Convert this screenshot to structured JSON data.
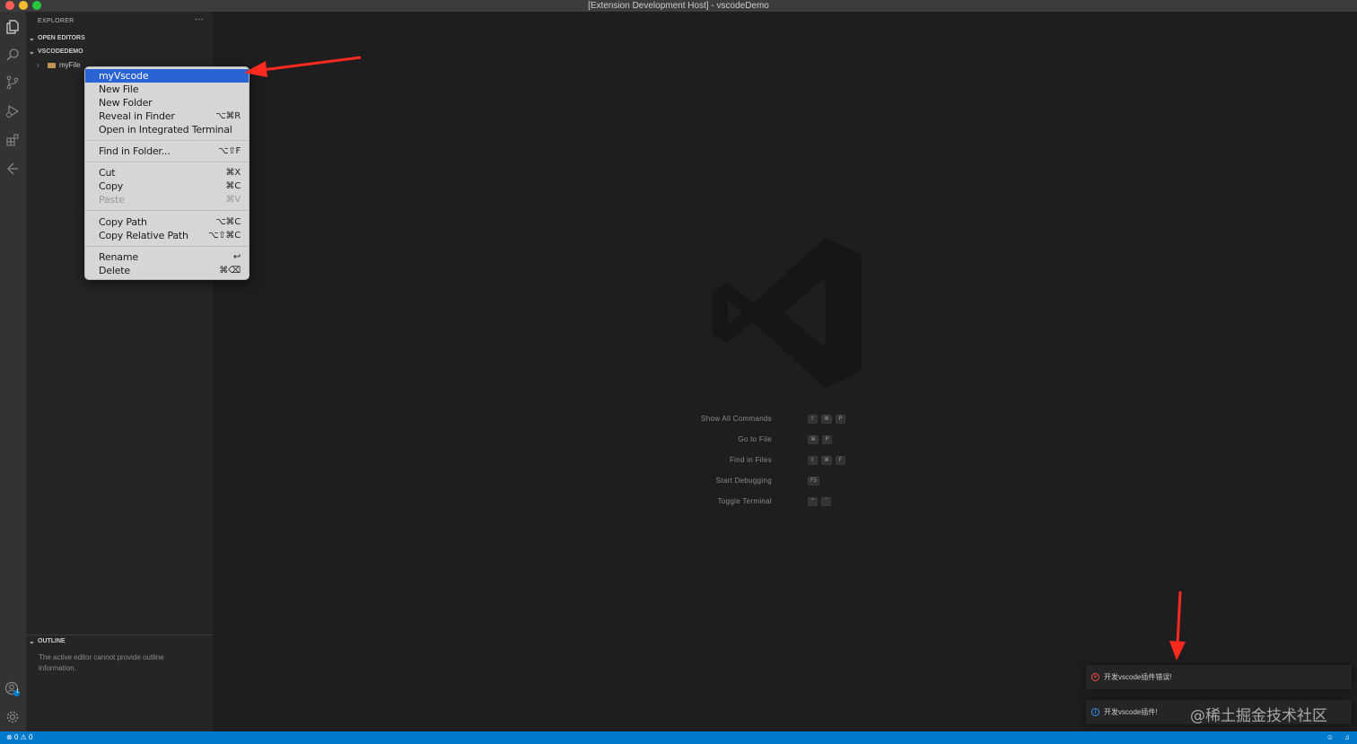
{
  "window": {
    "title": "[Extension Development Host] - vscodeDemo"
  },
  "activity_bar": {
    "icons": [
      "files-icon",
      "search-icon",
      "source-control-icon",
      "run-debug-icon",
      "extensions-icon",
      "remote-icon",
      "accounts-icon",
      "settings-gear-icon"
    ],
    "accounts_badge": "1"
  },
  "sidebar": {
    "header": "EXPLORER",
    "more": "···",
    "open_editors": "OPEN EDITORS",
    "workspace": "VSCODEDEMO",
    "tree": [
      {
        "label": "myFile"
      }
    ],
    "outline": {
      "header": "OUTLINE",
      "message": "The active editor cannot provide outline information."
    }
  },
  "context_menu": {
    "items": [
      {
        "label": "myVscode",
        "shortcut": ""
      },
      {
        "label": "New File",
        "shortcut": ""
      },
      {
        "label": "New Folder",
        "shortcut": ""
      },
      {
        "label": "Reveal in Finder",
        "shortcut": "⌥⌘R"
      },
      {
        "label": "Open in Integrated Terminal",
        "shortcut": ""
      },
      {
        "label": "Find in Folder...",
        "shortcut": "⌥⇧F"
      },
      {
        "label": "Cut",
        "shortcut": "⌘X"
      },
      {
        "label": "Copy",
        "shortcut": "⌘C"
      },
      {
        "label": "Paste",
        "shortcut": "⌘V"
      },
      {
        "label": "Copy Path",
        "shortcut": "⌥⌘C"
      },
      {
        "label": "Copy Relative Path",
        "shortcut": "⌥⇧⌘C"
      },
      {
        "label": "Rename",
        "shortcut": "↩"
      },
      {
        "label": "Delete",
        "shortcut": "⌘⌫"
      }
    ]
  },
  "editor_shortcuts": [
    {
      "label": "Show All Commands",
      "keys": [
        "⇧",
        "⌘",
        "P"
      ]
    },
    {
      "label": "Go to File",
      "keys": [
        "⌘",
        "P"
      ]
    },
    {
      "label": "Find in Files",
      "keys": [
        "⇧",
        "⌘",
        "F"
      ]
    },
    {
      "label": "Start Debugging",
      "keys": [
        "F5"
      ]
    },
    {
      "label": "Toggle Terminal",
      "keys": [
        "^",
        "`"
      ]
    }
  ],
  "notifications": [
    {
      "type": "error",
      "message": "开发vscode插件错误!"
    },
    {
      "type": "info",
      "message": "开发vscode插件!"
    }
  ],
  "site_watermark": "@稀土掘金技术社区",
  "status_bar": {
    "errors": "0",
    "warnings": "0"
  },
  "colors": {
    "accent": "#007acc",
    "menu_highlight": "#2a63d4",
    "annotation_arrow": "#ff2a1f"
  }
}
